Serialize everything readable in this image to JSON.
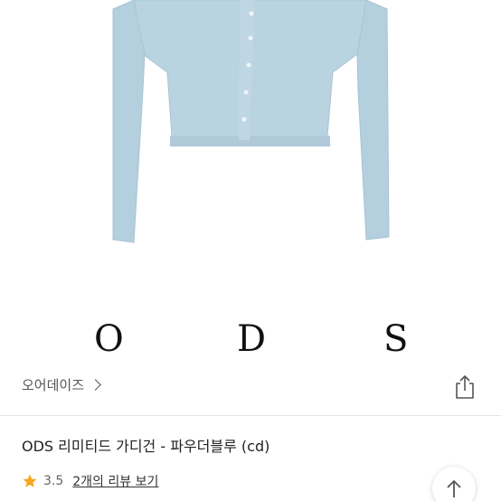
{
  "product_image": {
    "alt": "파우더블루 가디건 상품 이미지",
    "garment_color": "#b9d3e1"
  },
  "brand_logo": {
    "letters": [
      "O",
      "D",
      "S"
    ]
  },
  "store": {
    "name": "오어데이즈",
    "chevron_icon": "chevron-right-icon",
    "share_icon": "share-icon"
  },
  "product": {
    "title": "ODS 리미티드 가디건 - 파우더블루 (cd)"
  },
  "rating": {
    "star_icon": "star-icon",
    "star_color": "#f5a623",
    "value": "3.5",
    "review_link": "2개의 리뷰 보기"
  },
  "scroll_top": {
    "icon": "arrow-up-icon"
  }
}
